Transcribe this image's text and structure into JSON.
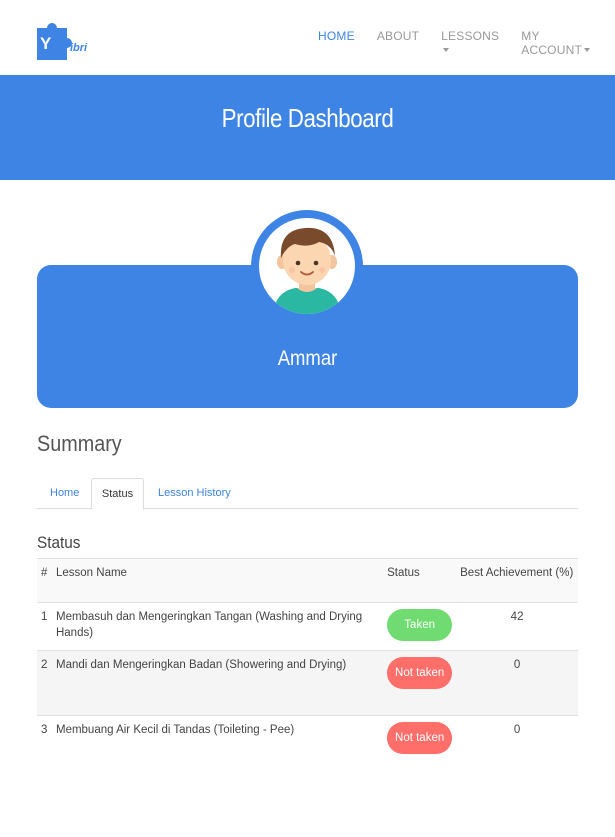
{
  "brand": {
    "logo_text": "Y ibri"
  },
  "nav": {
    "items": [
      {
        "label": "HOME",
        "active": true,
        "dropdown": false
      },
      {
        "label": "ABOUT",
        "active": false,
        "dropdown": false
      },
      {
        "label": "LESSONS",
        "active": false,
        "dropdown": true
      },
      {
        "label": "MY ACCOUNT",
        "active": false,
        "dropdown": true
      }
    ]
  },
  "hero": {
    "title": "Profile Dashboard"
  },
  "profile": {
    "name": "Ammar"
  },
  "summary": {
    "title": "Summary",
    "tabs": [
      {
        "label": "Home",
        "active": false
      },
      {
        "label": "Status",
        "active": true
      },
      {
        "label": "Lesson History",
        "active": false
      }
    ]
  },
  "status": {
    "heading": "Status",
    "columns": {
      "num": "#",
      "lesson": "Lesson Name",
      "status": "Status",
      "best": "Best Achievement (%)"
    },
    "rows": [
      {
        "num": "1",
        "lesson": "Membasuh dan Mengeringkan Tangan (Washing and Drying Hands)",
        "status": "Taken",
        "best": "42"
      },
      {
        "num": "2",
        "lesson": "Mandi dan Mengeringkan Badan (Showering and Drying)",
        "status": "Not taken",
        "best": "0"
      },
      {
        "num": "3",
        "lesson": "Membuang Air Kecil di Tandas (Toileting - Pee)",
        "status": "Not taken",
        "best": "0"
      }
    ]
  },
  "colors": {
    "primary": "#3d84e4",
    "taken": "#6fdb70",
    "not_taken": "#ff6e69"
  }
}
